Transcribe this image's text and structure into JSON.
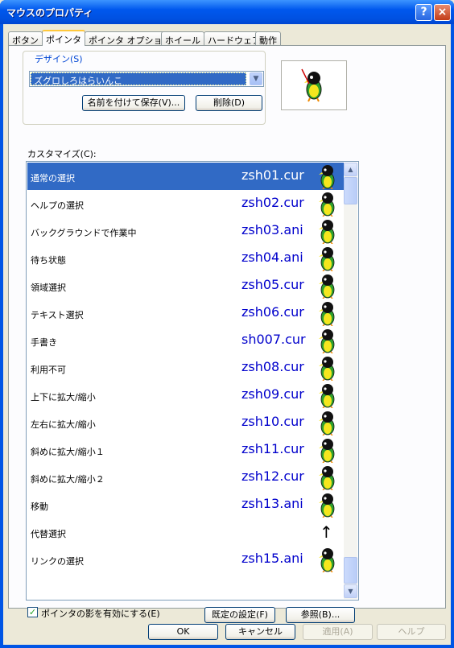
{
  "window": {
    "title": "マウスのプロパティ",
    "help_btn": "?",
    "close_btn": "×"
  },
  "tabs": [
    {
      "label": "ボタン"
    },
    {
      "label": "ポインタ",
      "active": true
    },
    {
      "label": "ポインタ オプション"
    },
    {
      "label": "ホイール"
    },
    {
      "label": "ハードウェア"
    },
    {
      "label": "動作"
    }
  ],
  "design": {
    "label": "デザイン(S)",
    "selected_scheme": "ズグロしろはらいんこ",
    "save_as_label": "名前を付けて保存(V)...",
    "delete_label": "削除(D)"
  },
  "customize_label": "カスタマイズ(C):",
  "pointers": [
    {
      "name": "通常の選択",
      "file": "zsh01.cur",
      "icon": "bird-normal-icon",
      "selected": true
    },
    {
      "name": "ヘルプの選択",
      "file": "zsh02.cur",
      "icon": "bird-help-icon"
    },
    {
      "name": "バックグラウンドで作業中",
      "file": "zsh03.ani",
      "icon": "bird-working-icon"
    },
    {
      "name": "待ち状態",
      "file": "zsh04.ani",
      "icon": "bird-busy-icon"
    },
    {
      "name": "領域選択",
      "file": "zsh05.cur",
      "icon": "bird-precision-icon"
    },
    {
      "name": "テキスト選択",
      "file": "zsh06.cur",
      "icon": "bird-text-icon"
    },
    {
      "name": "手書き",
      "file": "sh007.cur",
      "icon": "bird-handwriting-icon"
    },
    {
      "name": "利用不可",
      "file": "zsh08.cur",
      "icon": "bird-unavailable-icon"
    },
    {
      "name": "上下に拡大/縮小",
      "file": "zsh09.cur",
      "icon": "bird-resize-ns-icon"
    },
    {
      "name": "左右に拡大/縮小",
      "file": "zsh10.cur",
      "icon": "bird-resize-ew-icon"
    },
    {
      "name": "斜めに拡大/縮小１",
      "file": "zsh11.cur",
      "icon": "bird-resize-nwse-icon"
    },
    {
      "name": "斜めに拡大/縮小２",
      "file": "zsh12.cur",
      "icon": "bird-resize-nesw-icon"
    },
    {
      "name": "移動",
      "file": "zsh13.ani",
      "icon": "bird-move-icon"
    },
    {
      "name": "代替選択",
      "file": "",
      "icon": "up-arrow-icon",
      "glyph": "↑"
    },
    {
      "name": "リンクの選択",
      "file": "zsh15.ani",
      "icon": "bird-link-icon"
    }
  ],
  "shadow_option": {
    "label": "ポインタの影を有効にする(E)",
    "checked": true
  },
  "default_btn": "既定の設定(F)",
  "browse_btn": "参照(B)...",
  "footer": {
    "ok": "OK",
    "cancel": "キャンセル",
    "apply": "適用(A)",
    "help": "ヘルプ"
  },
  "colors": {
    "selection": "#316ac5",
    "file_text": "#0000cc",
    "bird_yellow": "#f5e61e",
    "bird_green": "#2ea02e",
    "bird_black": "#111111"
  }
}
